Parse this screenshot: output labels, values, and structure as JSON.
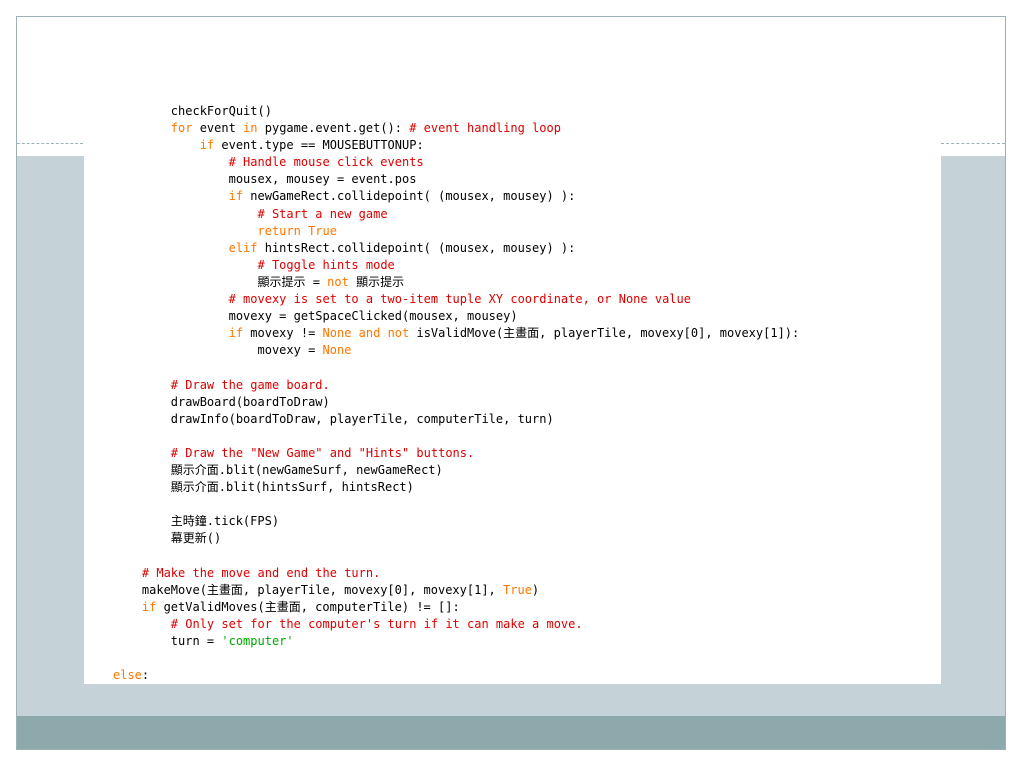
{
  "colors": {
    "keyword": "#ff7700",
    "comment": "#dd0000",
    "string": "#00aa00",
    "plain": "#000000",
    "band_gray": "#c5d2d8",
    "band_teal": "#8ea9ab"
  },
  "code_lines": [
    [
      [
        "p",
        "        checkForQuit()"
      ]
    ],
    [
      [
        "p",
        "        "
      ],
      [
        "k",
        "for"
      ],
      [
        "p",
        " event "
      ],
      [
        "k",
        "in"
      ],
      [
        "p",
        " pygame.event.get(): "
      ],
      [
        "c",
        "# event handling loop"
      ]
    ],
    [
      [
        "p",
        "            "
      ],
      [
        "k",
        "if"
      ],
      [
        "p",
        " event.type == MOUSEBUTTONUP:"
      ]
    ],
    [
      [
        "p",
        "                "
      ],
      [
        "c",
        "# Handle mouse click events"
      ]
    ],
    [
      [
        "p",
        "                mousex, mousey = event.pos"
      ]
    ],
    [
      [
        "p",
        "                "
      ],
      [
        "k",
        "if"
      ],
      [
        "p",
        " newGameRect.collidepoint( (mousex, mousey) ):"
      ]
    ],
    [
      [
        "p",
        "                    "
      ],
      [
        "c",
        "# Start a new game"
      ]
    ],
    [
      [
        "p",
        "                    "
      ],
      [
        "k",
        "return True"
      ]
    ],
    [
      [
        "p",
        "                "
      ],
      [
        "k",
        "elif"
      ],
      [
        "p",
        " hintsRect.collidepoint( (mousex, mousey) ):"
      ]
    ],
    [
      [
        "p",
        "                    "
      ],
      [
        "c",
        "# Toggle hints mode"
      ]
    ],
    [
      [
        "p",
        "                    顯示提示 = "
      ],
      [
        "k",
        "not"
      ],
      [
        "p",
        " 顯示提示"
      ]
    ],
    [
      [
        "p",
        "                "
      ],
      [
        "c",
        "# movexy is set to a two-item tuple XY coordinate, or None value"
      ]
    ],
    [
      [
        "p",
        "                movexy = getSpaceClicked(mousex, mousey)"
      ]
    ],
    [
      [
        "p",
        "                "
      ],
      [
        "k",
        "if"
      ],
      [
        "p",
        " movexy != "
      ],
      [
        "k",
        "None"
      ],
      [
        "p",
        " "
      ],
      [
        "k",
        "and not"
      ],
      [
        "p",
        " isValidMove(主畫面, playerTile, movexy[0], movexy[1]):"
      ]
    ],
    [
      [
        "p",
        "                    movexy = "
      ],
      [
        "k",
        "None"
      ]
    ],
    [
      [
        "p",
        ""
      ]
    ],
    [
      [
        "p",
        "        "
      ],
      [
        "c",
        "# Draw the game board."
      ]
    ],
    [
      [
        "p",
        "        drawBoard(boardToDraw)"
      ]
    ],
    [
      [
        "p",
        "        drawInfo(boardToDraw, playerTile, computerTile, turn)"
      ]
    ],
    [
      [
        "p",
        ""
      ]
    ],
    [
      [
        "p",
        "        "
      ],
      [
        "c",
        "# Draw the \"New Game\" and \"Hints\" buttons."
      ]
    ],
    [
      [
        "p",
        "        顯示介面.blit(newGameSurf, newGameRect)"
      ]
    ],
    [
      [
        "p",
        "        顯示介面.blit(hintsSurf, hintsRect)"
      ]
    ],
    [
      [
        "p",
        ""
      ]
    ],
    [
      [
        "p",
        "        主時鐘.tick(FPS)"
      ]
    ],
    [
      [
        "p",
        "        幕更新()"
      ]
    ],
    [
      [
        "p",
        ""
      ]
    ],
    [
      [
        "p",
        "    "
      ],
      [
        "c",
        "# Make the move and end the turn."
      ]
    ],
    [
      [
        "p",
        "    makeMove(主畫面, playerTile, movexy[0], movexy[1], "
      ],
      [
        "k",
        "True"
      ],
      [
        "p",
        ")"
      ]
    ],
    [
      [
        "p",
        "    "
      ],
      [
        "k",
        "if"
      ],
      [
        "p",
        " getValidMoves(主畫面, computerTile) != []:"
      ]
    ],
    [
      [
        "p",
        "        "
      ],
      [
        "c",
        "# Only set for the computer's turn if it can make a move."
      ]
    ],
    [
      [
        "p",
        "        turn = "
      ],
      [
        "s",
        "'computer'"
      ]
    ],
    [
      [
        "p",
        ""
      ]
    ],
    [
      [
        "k",
        "else"
      ],
      [
        "p",
        ":"
      ]
    ]
  ]
}
